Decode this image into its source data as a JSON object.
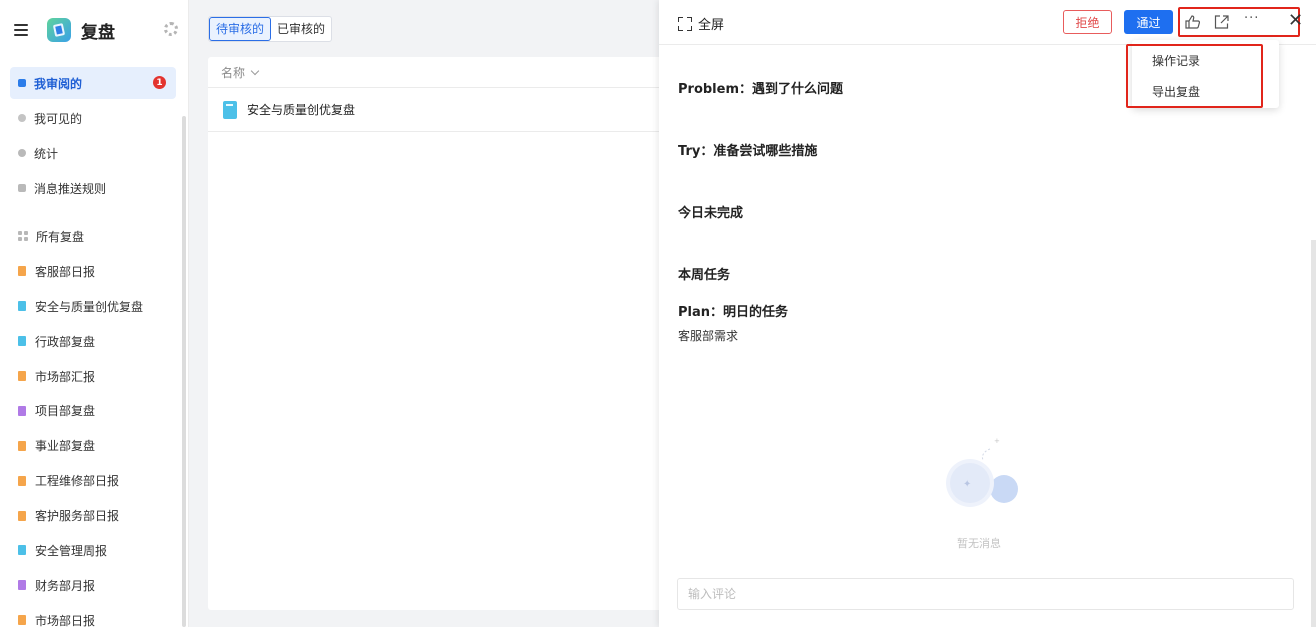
{
  "app": {
    "title": "复盘"
  },
  "nav": [
    {
      "label": "我审阅的",
      "badge": "1",
      "color": "#2b7ce9"
    },
    {
      "label": "我可见的",
      "color": "#c4c4c4"
    },
    {
      "label": "统计",
      "color": "#b9b9b9"
    },
    {
      "label": "消息推送规则",
      "color": "#b9b9b9"
    }
  ],
  "all_reviews_label": "所有复盘",
  "review_lists": [
    {
      "label": "客服部日报",
      "color": "#f5a54b"
    },
    {
      "label": "安全与质量创优复盘",
      "color": "#4cc0e8"
    },
    {
      "label": "行政部复盘",
      "color": "#4cc0e8"
    },
    {
      "label": "市场部汇报",
      "color": "#f5a54b"
    },
    {
      "label": "项目部复盘",
      "color": "#b07ae6"
    },
    {
      "label": "事业部复盘",
      "color": "#f5a54b"
    },
    {
      "label": "工程维修部日报",
      "color": "#f5a54b"
    },
    {
      "label": "客护服务部日报",
      "color": "#f5a54b"
    },
    {
      "label": "安全管理周报",
      "color": "#4cc0e8"
    },
    {
      "label": "财务部月报",
      "color": "#b07ae6"
    },
    {
      "label": "市场部日报",
      "color": "#f5a54b"
    }
  ],
  "tabs": {
    "pending": "待审核的",
    "reviewed": "已审核的"
  },
  "table": {
    "column_name": "名称",
    "rows": [
      {
        "name": "安全与质量创优复盘"
      }
    ]
  },
  "panel": {
    "fullscreen_label": "全屏",
    "reject_label": "拒绝",
    "pass_label": "通过",
    "more_label": "···",
    "dropdown": {
      "items": [
        "操作记录",
        "导出复盘"
      ]
    },
    "sections": {
      "problem": "Problem：遇到了什么问题",
      "try": "Try：准备尝试哪些措施",
      "unfinished": "今日未完成",
      "weekly": "本周任务",
      "plan": "Plan：明日的任务",
      "plan_text": "客服部需求"
    },
    "empty_text": "暂无消息",
    "comment_placeholder": "输入评论"
  }
}
